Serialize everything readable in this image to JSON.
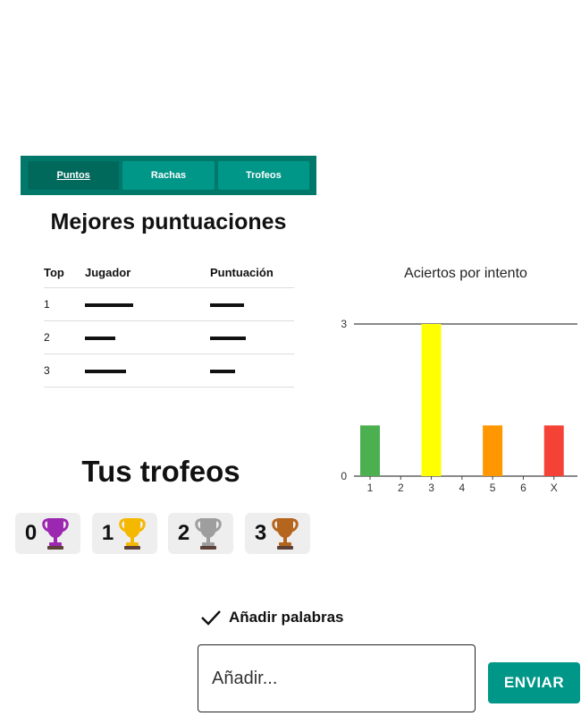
{
  "tabs": [
    {
      "label": "Puntos",
      "active": true
    },
    {
      "label": "Rachas",
      "active": false
    },
    {
      "label": "Trofeos",
      "active": false
    }
  ],
  "scores": {
    "title": "Mejores puntuaciones",
    "headers": [
      "Top",
      "Jugador",
      "Puntuación"
    ],
    "rows": [
      {
        "rank": "1",
        "player_redacted": true,
        "score_redacted": true
      },
      {
        "rank": "2",
        "player_redacted": true,
        "score_redacted": true
      },
      {
        "rank": "3",
        "player_redacted": true,
        "score_redacted": true
      }
    ]
  },
  "chart_data": {
    "type": "bar",
    "title": "Aciertos por intento",
    "categories": [
      "1",
      "2",
      "3",
      "4",
      "5",
      "6",
      "X"
    ],
    "values": [
      1,
      0,
      3,
      0,
      1,
      0,
      1
    ],
    "colors": [
      "#4caf50",
      "#4caf50",
      "#ffff00",
      "#ff9800",
      "#ff9800",
      "#f44336",
      "#f44336"
    ],
    "yticks": [
      "0",
      "3"
    ],
    "ylim": [
      0,
      3
    ],
    "xlabel": "",
    "ylabel": "",
    "legend": "none"
  },
  "trophies": {
    "title": "Tus trofeos",
    "items": [
      {
        "count": "0",
        "icon": "purple-trophy-icon",
        "color": "#9c27b0"
      },
      {
        "count": "1",
        "icon": "gold-trophy-icon",
        "color": "#f5b800"
      },
      {
        "count": "2",
        "icon": "silver-trophy-icon",
        "color": "#9e9e9e"
      },
      {
        "count": "3",
        "icon": "bronze-trophy-icon",
        "color": "#b5651d"
      }
    ]
  },
  "add_words": {
    "label": "Añadir palabras",
    "placeholder": "Añadir...",
    "submit_label": "ENVIAR"
  },
  "colors": {
    "accent": "#009688",
    "accent_dark": "#00796b"
  }
}
